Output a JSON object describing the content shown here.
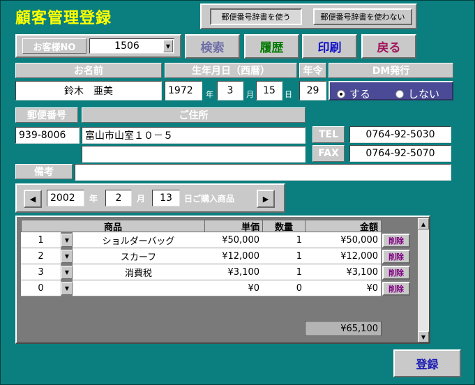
{
  "title": "顧客管理登録",
  "dict_toggle": {
    "use": "郵便番号辞書を使う",
    "nouse": "郵便番号辞書を使わない"
  },
  "customer_no": {
    "label": "お客様NO",
    "value": "1506"
  },
  "buttons": {
    "search": "検索",
    "history": "履歴",
    "print": "印刷",
    "back": "戻る",
    "register": "登録"
  },
  "colors": {
    "search": "#6d6da8",
    "history": "#007a00",
    "print": "#1010c8",
    "back": "#a0155a"
  },
  "name": {
    "label": "お名前",
    "value": "鈴木　亜美"
  },
  "birthday": {
    "label": "生年月日（西暦）",
    "year": "1972",
    "year_unit": "年",
    "month": "3",
    "month_unit": "月",
    "day": "15",
    "day_unit": "日"
  },
  "age": {
    "label": "年令",
    "value": "29"
  },
  "dm": {
    "label": "DM発行",
    "yes": "する",
    "no": "しない",
    "selected": "yes"
  },
  "postal": {
    "label": "郵便番号",
    "value": "939-8006"
  },
  "address": {
    "label": "ご住所",
    "line1": "富山市山室１０－５",
    "line2": ""
  },
  "tel": {
    "label": "TEL",
    "value": "0764-92-5030"
  },
  "fax": {
    "label": "FAX",
    "value": "0764-92-5070"
  },
  "notes": {
    "label": "備考",
    "value": ""
  },
  "purchase_date": {
    "year": "2002",
    "year_unit": "年",
    "month": "2",
    "month_unit": "月",
    "day": "13",
    "suffix": "日ご購入商品"
  },
  "table": {
    "headers": {
      "product": "商品",
      "price": "単価",
      "qty": "数量",
      "amount": "金額"
    },
    "rows": [
      {
        "no": "1",
        "product": "ショルダーバッグ",
        "price": "¥50,000",
        "qty": "1",
        "amount": "¥50,000"
      },
      {
        "no": "2",
        "product": "スカーフ",
        "price": "¥12,000",
        "qty": "1",
        "amount": "¥12,000"
      },
      {
        "no": "3",
        "product": "消費税",
        "price": "¥3,100",
        "qty": "1",
        "amount": "¥3,100"
      },
      {
        "no": "0",
        "product": "",
        "price": "¥0",
        "qty": "0",
        "amount": "¥0"
      }
    ],
    "delete_label": "削除",
    "total": "¥65,100"
  }
}
